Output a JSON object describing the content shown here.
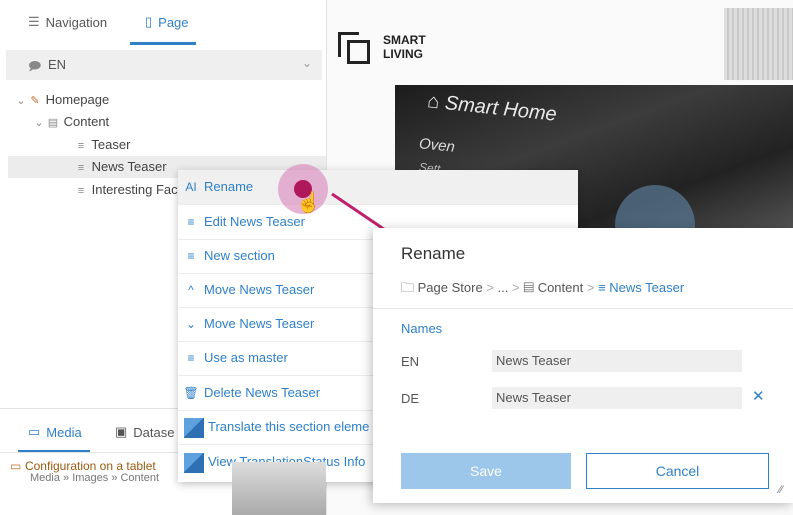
{
  "left_panel": {
    "tabs": [
      {
        "label": "Navigation",
        "icon": "list-icon"
      },
      {
        "label": "Page",
        "icon": "page-icon"
      }
    ],
    "language": "EN",
    "tree": [
      {
        "label": "Homepage",
        "icon": "pencil-icon"
      },
      {
        "label": "Content",
        "icon": "content-icon"
      },
      {
        "label": "Teaser",
        "icon": "section-icon"
      },
      {
        "label": "News Teaser",
        "icon": "section-icon"
      },
      {
        "label": "Interesting Fac",
        "icon": "section-icon"
      }
    ],
    "bottom_tabs": [
      {
        "label": "Media",
        "icon": "media-icon"
      },
      {
        "label": "Datase",
        "icon": "dataset-icon"
      }
    ],
    "search_result": {
      "title": "Configuration on a tablet",
      "path": "Media » Images » Content"
    }
  },
  "preview": {
    "brand_line1": "SMART",
    "brand_line2": "LIVING",
    "hero_title": "Smart Home",
    "hero_line1": "Oven",
    "hero_line2": "Sett"
  },
  "context_menu": {
    "items": [
      {
        "label": "Rename",
        "icon": "rename-icon"
      },
      {
        "label": "Edit News Teaser",
        "icon": "edit-icon"
      },
      {
        "label": "New section",
        "icon": "new-section-icon"
      },
      {
        "label": "Move News Teaser",
        "icon": "move-up-icon"
      },
      {
        "label": "Move News Teaser",
        "icon": "move-down-icon"
      },
      {
        "label": "Use as master",
        "icon": "master-icon"
      },
      {
        "label": "Delete News Teaser",
        "icon": "trash-icon"
      },
      {
        "label": "Translate this section eleme",
        "icon": "translate-icon"
      },
      {
        "label": "View TranslationStatus Info",
        "icon": "translation-status-icon"
      }
    ]
  },
  "dialog": {
    "title": "Rename",
    "breadcrumb": [
      "Page Store",
      "...",
      "Content",
      "News Teaser"
    ],
    "section_label": "Names",
    "fields": [
      {
        "lang": "EN",
        "value": "News Teaser"
      },
      {
        "lang": "DE",
        "value": "News Teaser"
      }
    ],
    "save_label": "Save",
    "cancel_label": "Cancel"
  },
  "colors": {
    "accent": "#2f80c8",
    "save_disabled": "#9cc6ea",
    "cursor": "#b0185c",
    "arrow": "#c0206c"
  }
}
